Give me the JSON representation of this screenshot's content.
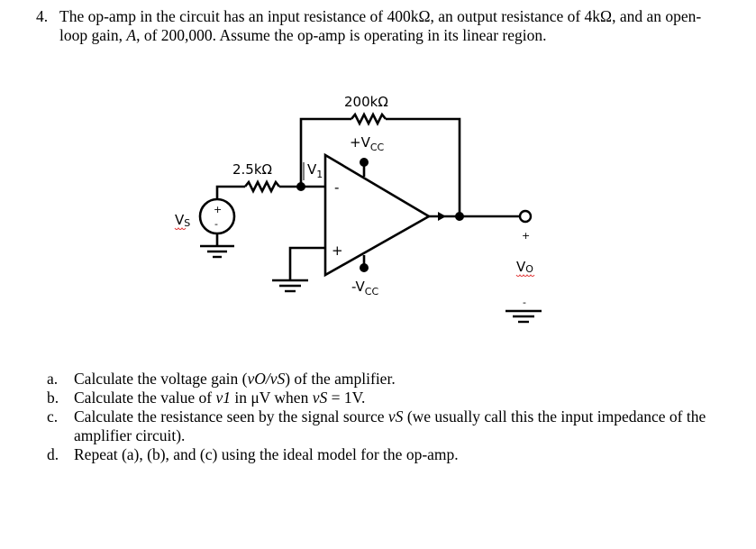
{
  "problem": {
    "number": "4.",
    "intro_pre_gain": "The op-amp in the circuit has an input resistance of 400kΩ, an output resistance of 4kΩ, and an open-loop gain, ",
    "gain_symbol": "A",
    "intro_post_gain": ", of 200,000.  Assume the op-amp is operating in its linear region."
  },
  "circuit": {
    "feedback_resistor": "200kΩ",
    "input_resistor": "2.5kΩ",
    "node_label": "V",
    "node_label_sub": "1",
    "source_label": "V",
    "source_label_sub": "S",
    "source_plus": "+",
    "source_minus": "-",
    "inverting_sign": "-",
    "noninverting_sign": "+",
    "pos_supply": "+V",
    "pos_supply_sub": "CC",
    "neg_supply": "-V",
    "neg_supply_sub": "CC",
    "output_label": "V",
    "output_label_sub": "O",
    "output_plus": "+",
    "output_minus": "-"
  },
  "parts": [
    {
      "label": "a.",
      "segments": [
        "Calculate the voltage gain (",
        "vO/vS",
        ") of the amplifier."
      ]
    },
    {
      "label": "b.",
      "segments": [
        "Calculate the value of ",
        "v1",
        " in μV when ",
        "vS",
        " = 1V."
      ]
    },
    {
      "label": "c.",
      "segments": [
        "Calculate the resistance seen by the signal source ",
        "vS",
        " (we usually call this the input impedance of the amplifier circuit)."
      ]
    },
    {
      "label": "d.",
      "segments": [
        "Repeat (a), (b), and (c) using the ideal model for the op-amp."
      ]
    }
  ]
}
